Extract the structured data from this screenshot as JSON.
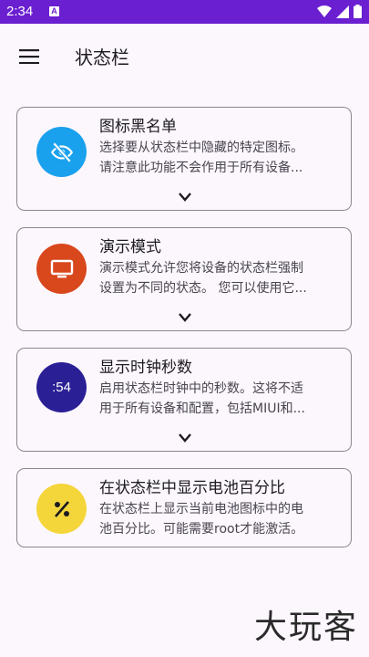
{
  "status_bar": {
    "time": "2:34",
    "notification_glyph": "A",
    "bg_color": "#6a1fd0",
    "icons": [
      "wifi-icon",
      "signal-icon",
      "battery-icon"
    ]
  },
  "app_bar": {
    "menu_icon": "hamburger-menu-icon",
    "title": "状态栏"
  },
  "cards": [
    {
      "title": "图标黑名单",
      "desc_lines": [
        "选择要从状态栏中隐藏的特定图标。",
        "请注意此功能不会作用于所有设备..."
      ],
      "icon": "eye-off-icon",
      "icon_color": "#1aa1ee",
      "expand_icon": "chevron-down-icon"
    },
    {
      "title": "演示模式",
      "desc_lines": [
        "演示模式允许您将设备的状态栏强制",
        "设置为不同的状态。 您可以使用它..."
      ],
      "icon": "monitor-icon",
      "icon_color": "#d9471d",
      "expand_icon": "chevron-down-icon"
    },
    {
      "title": "显示时钟秒数",
      "desc_lines": [
        "启用状态栏时钟中的秒数。这将不适",
        "用于所有设备和配置，包括MIUI和..."
      ],
      "icon": "clock-seconds-icon",
      "icon_text": ":54",
      "icon_color": "#2b1f96",
      "expand_icon": "chevron-down-icon"
    },
    {
      "title": "在状态栏中显示电池百分比",
      "desc_lines": [
        "在状态栏上显示当前电池图标中的电",
        "池百分比。可能需要root才能激活。"
      ],
      "icon": "percent-icon",
      "icon_color": "#f4d63b"
    }
  ],
  "watermark": "大玩客"
}
